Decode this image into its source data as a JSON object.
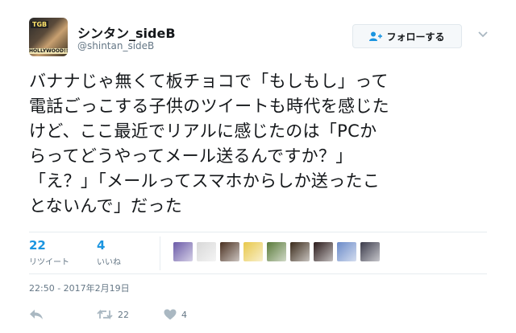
{
  "author": {
    "display_name": "シンタン_sideB",
    "handle": "@shintan_sideB",
    "avatar_text_top": "TGB",
    "avatar_text_bottom": "HOLLYWOOD!!"
  },
  "follow_button": {
    "label": "フォローする"
  },
  "tweet": {
    "lines": [
      "バナナじゃ無くて板チョコで「もしもし」って",
      "電話ごっこする子供のツイートも時代を感じた",
      "けど、ここ最近でリアルに感じたのは「PCか",
      "らってどうやってメール送るんですか？」",
      "「え？」「メールってスマホからしか送ったこ",
      "とないんで」だった"
    ]
  },
  "stats": {
    "retweets": {
      "count": "22",
      "label": "リツイート"
    },
    "likes": {
      "count": "4",
      "label": "いいね"
    }
  },
  "liker_avatar_colors": [
    "#6b5aa8",
    "#d8d8d8",
    "#4a3020",
    "#e8c84a",
    "#5a7a3a",
    "#3a2a1a",
    "#2a1a1a",
    "#6a8ac8",
    "#3a3a4a"
  ],
  "timestamp": "22:50 - 2017年2月19日",
  "actions": {
    "retweet_count": "22",
    "like_count": "4"
  },
  "colors": {
    "link_blue": "#1b95e0",
    "muted_gray": "#657786",
    "text": "#14171a"
  }
}
